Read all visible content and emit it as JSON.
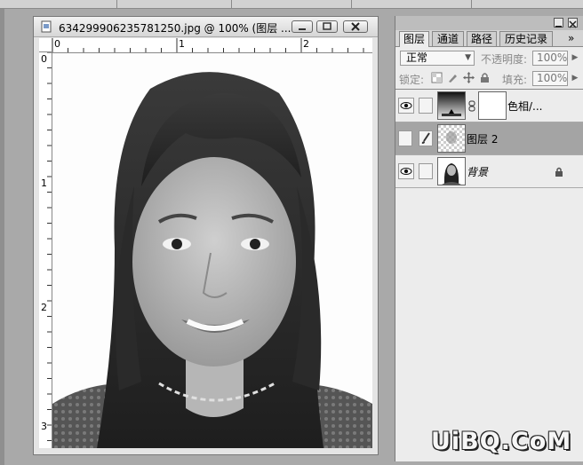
{
  "document": {
    "title": "634299906235781250.jpg @ 100% (图层 ...",
    "ruler_top_labels": [
      "0",
      "1",
      "2"
    ],
    "ruler_left_labels": [
      "0",
      "1",
      "2",
      "3"
    ]
  },
  "panel": {
    "tabs": [
      {
        "label": "图层",
        "active": true
      },
      {
        "label": "通道",
        "active": false
      },
      {
        "label": "路径",
        "active": false
      },
      {
        "label": "历史记录",
        "active": false
      }
    ],
    "blend_mode": "正常",
    "opacity_label": "不透明度:",
    "opacity_value": "100%",
    "lock_label": "锁定:",
    "fill_label": "填充:",
    "fill_value": "100%",
    "layers": [
      {
        "name": "色相/...",
        "visible": true,
        "selected": false,
        "type": "adjustment",
        "icon": "adjustment-gradient-icon"
      },
      {
        "name": "图层 2",
        "visible": false,
        "selected": true,
        "type": "layer",
        "icon": "brush-icon"
      },
      {
        "name": "背景",
        "visible": true,
        "selected": false,
        "type": "background",
        "icon": "lock-icon"
      }
    ]
  },
  "watermark": "UiBQ.CoM"
}
